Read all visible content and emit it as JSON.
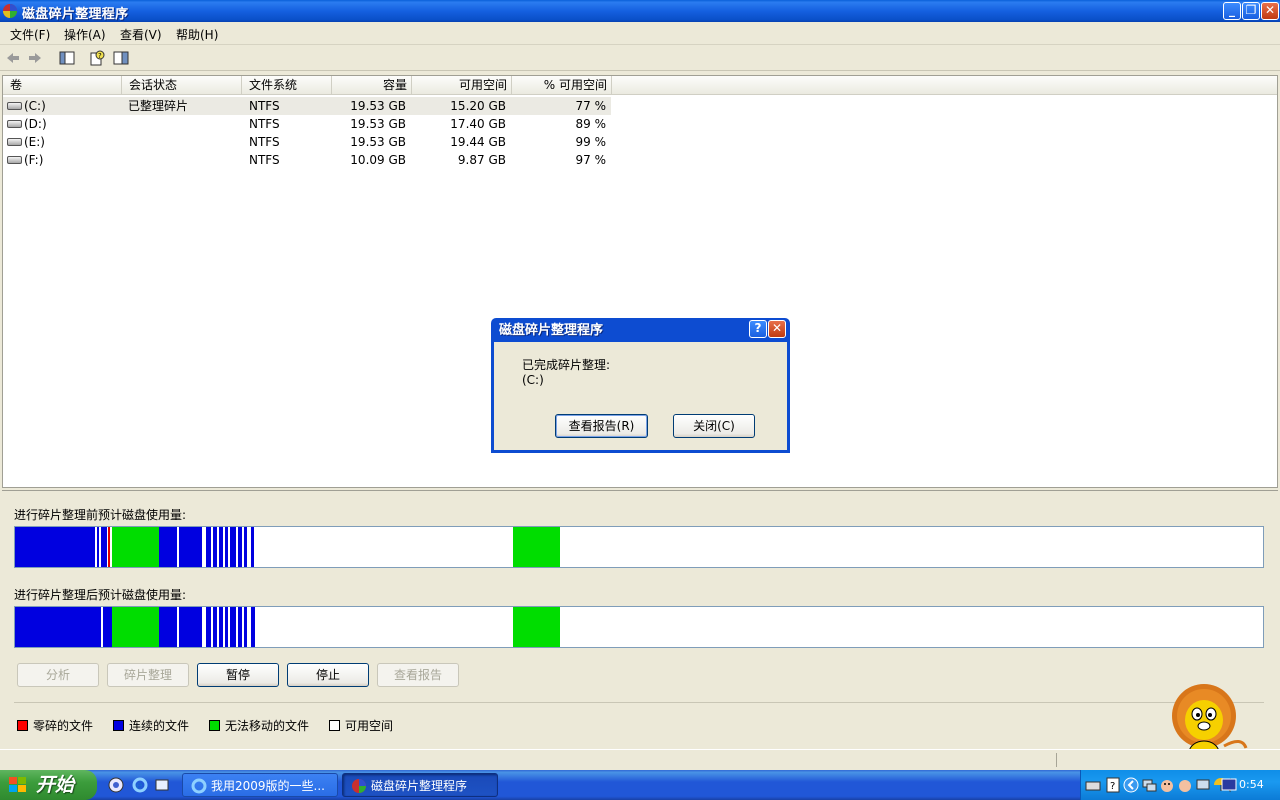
{
  "window": {
    "title": "磁盘碎片整理程序"
  },
  "menu": [
    "文件(F)",
    "操作(A)",
    "查看(V)",
    "帮助(H)"
  ],
  "columns": {
    "volume": "卷",
    "session_status": "会话状态",
    "filesystem": "文件系统",
    "capacity": "容量",
    "free_space": "可用空间",
    "pct_free": "% 可用空间"
  },
  "volumes": [
    {
      "name": "(C:)",
      "status": "已整理碎片",
      "fs": "NTFS",
      "capacity": "19.53 GB",
      "free": "15.20 GB",
      "pct": "77 %"
    },
    {
      "name": "(D:)",
      "status": "",
      "fs": "NTFS",
      "capacity": "19.53 GB",
      "free": "17.40 GB",
      "pct": "89 %"
    },
    {
      "name": "(E:)",
      "status": "",
      "fs": "NTFS",
      "capacity": "19.53 GB",
      "free": "19.44 GB",
      "pct": "99 %"
    },
    {
      "name": "(F:)",
      "status": "",
      "fs": "NTFS",
      "capacity": "10.09 GB",
      "free": "9.87 GB",
      "pct": "97 %"
    }
  ],
  "maps": {
    "before_label": "进行碎片整理前预计磁盘使用量:",
    "after_label": "进行碎片整理后预计磁盘使用量:"
  },
  "buttons": {
    "analyze": "分析",
    "defrag": "碎片整理",
    "pause": "暂停",
    "stop": "停止",
    "view_report": "查看报告"
  },
  "legend": {
    "fragmented": "零碎的文件",
    "contiguous": "连续的文件",
    "unmovable": "无法移动的文件",
    "free": "可用空间"
  },
  "colors": {
    "fragmented": "#ff0000",
    "contiguous": "#0000e0",
    "unmovable": "#00dd00",
    "free": "#ffffff"
  },
  "dialog": {
    "title": "磁盘碎片整理程序",
    "message": "已完成碎片整理:",
    "volume": "(C:)",
    "view_report_btn": "查看报告(R)",
    "close_btn": "关闭(C)"
  },
  "taskbar": {
    "start": "开始",
    "items": [
      "我用2009版的一些...",
      "磁盘碎片整理程序"
    ],
    "clock": "0:54"
  }
}
